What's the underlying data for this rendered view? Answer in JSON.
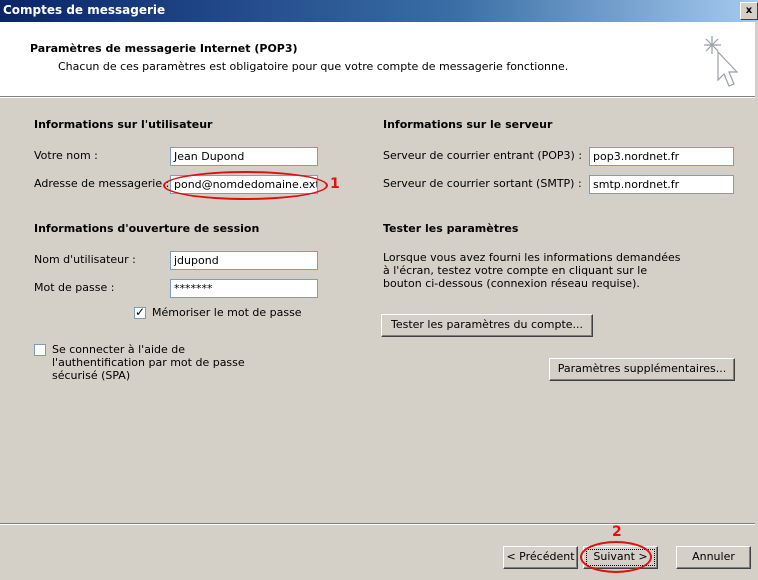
{
  "window": {
    "title": "Comptes de messagerie",
    "close_glyph": "x"
  },
  "header": {
    "title": "Paramètres de messagerie Internet (POP3)",
    "subtitle": "Chacun de ces paramètres est obligatoire pour que votre compte de messagerie fonctionne."
  },
  "user_info": {
    "heading": "Informations sur l'utilisateur",
    "name_label": "Votre nom :",
    "name_value": "Jean Dupond",
    "email_label": "Adresse de messagerie :",
    "email_value": "pond@nomdedomaine.ext"
  },
  "logon_info": {
    "heading": "Informations d'ouverture de session",
    "username_label": "Nom d'utilisateur :",
    "username_value": "jdupond",
    "password_label": "Mot de passe :",
    "password_value": "*******",
    "remember_label": "Mémoriser le mot de passe",
    "remember_checked": true,
    "spa_label_1": "Se connecter à l'aide de",
    "spa_label_2": "l'authentification par mot de passe",
    "spa_label_3": "sécurisé (SPA)",
    "spa_checked": false
  },
  "server_info": {
    "heading": "Informations sur le serveur",
    "incoming_label": "Serveur de courrier entrant (POP3) :",
    "incoming_value": "pop3.nordnet.fr",
    "outgoing_label": "Serveur de courrier sortant (SMTP) :",
    "outgoing_value": "smtp.nordnet.fr"
  },
  "test": {
    "heading": "Tester les paramètres",
    "desc_1": "Lorsque vous avez fourni les informations demandées",
    "desc_2": "à l'écran, testez votre compte en cliquant sur le",
    "desc_3": "bouton ci-dessous (connexion réseau requise).",
    "test_button": "Tester les paramètres du compte...",
    "more_button": "Paramètres supplémentaires..."
  },
  "footer": {
    "prev_button": "< Précédent",
    "next_button": "Suivant >",
    "cancel_button": "Annuler"
  },
  "annotations": {
    "mark_1": "1",
    "mark_2": "2",
    "color": "#e01010"
  },
  "icons": {
    "wizard": "wizard-cursor-icon",
    "close": "close-icon",
    "check": "check-icon"
  }
}
